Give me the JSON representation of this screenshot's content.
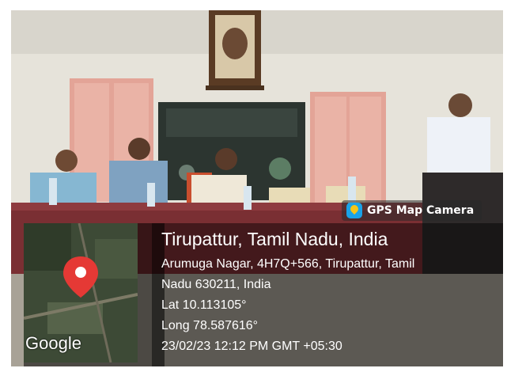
{
  "badge": {
    "label": "GPS Map Camera",
    "icon": "gps-map-camera-icon"
  },
  "location": {
    "title": "Tirupattur, Tamil Nadu, India",
    "address_line1": "Arumuga Nagar, 4H7Q+566, Tirupattur, Tamil",
    "address_line2": "Nadu 630211, India",
    "lat": "Lat 10.113105°",
    "long": "Long 78.587616°",
    "datetime": "23/02/23 12:12 PM GMT +05:30"
  },
  "map": {
    "provider": "Google",
    "pin_color": "#e53935"
  },
  "colors": {
    "wall": "#e9e6dc",
    "door": "#e8a99a",
    "board": "#2f3a33",
    "table": "#7a2f33"
  }
}
